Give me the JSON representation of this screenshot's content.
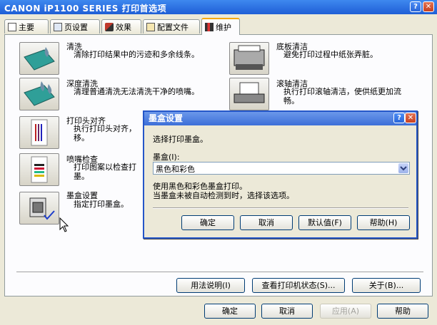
{
  "window": {
    "title": "CANON iP1100 SERIES 打印首选项",
    "help_btn": "?",
    "close_btn": "✕"
  },
  "tabs": [
    {
      "label": "主要",
      "icon": "document-icon"
    },
    {
      "label": "页设置",
      "icon": "page-setup-icon"
    },
    {
      "label": "效果",
      "icon": "brush-icon"
    },
    {
      "label": "配置文件",
      "icon": "profile-icon"
    },
    {
      "label": "维护",
      "icon": "maintenance-icon"
    }
  ],
  "maintenance": {
    "cleaning": {
      "title": "清洗",
      "desc": "清除打印结果中的污迹和多余线条。"
    },
    "deep_cleaning": {
      "title": "深度清洗",
      "desc": "清理普通清洗无法清洗干净的喷嘴。"
    },
    "head_alignment": {
      "title": "打印头对齐",
      "desc_line1": "执行打印头对齐，",
      "desc_line2": "移。"
    },
    "nozzle_check": {
      "title": "喷嘴检查",
      "desc_line1": "打印图案以检查打",
      "desc_line2": "墨。"
    },
    "ink_cartridge": {
      "title": "墨盒设置",
      "desc": "指定打印墨盒。"
    },
    "bottom_plate": {
      "title": "底板清洁",
      "desc": "避免打印过程中纸张弄脏。"
    },
    "roller_cleaning": {
      "title": "滚轴清洁",
      "desc_line1": "执行打印滚轴清洁，使供纸更加流",
      "desc_line2": "畅。"
    }
  },
  "panel_buttons": {
    "instructions": "用法说明(I)",
    "printer_status": "查看打印机状态(S)...",
    "about": "关于(B)..."
  },
  "footer_buttons": {
    "ok": "确定",
    "cancel": "取消",
    "apply": "应用(A)",
    "help": "帮助"
  },
  "dialog": {
    "title": "墨盒设置",
    "help_btn": "?",
    "close_btn": "✕",
    "prompt": "选择打印墨盒。",
    "combo_label": "墨盒(I):",
    "combo_value": "黑色和彩色",
    "note_line1": "使用黑色和彩色墨盒打印。",
    "note_line2": "当墨盒未被自动检测到时，选择该选项。",
    "buttons": {
      "ok": "确定",
      "cancel": "取消",
      "default": "默认值(F)",
      "help": "帮助(H)"
    }
  }
}
